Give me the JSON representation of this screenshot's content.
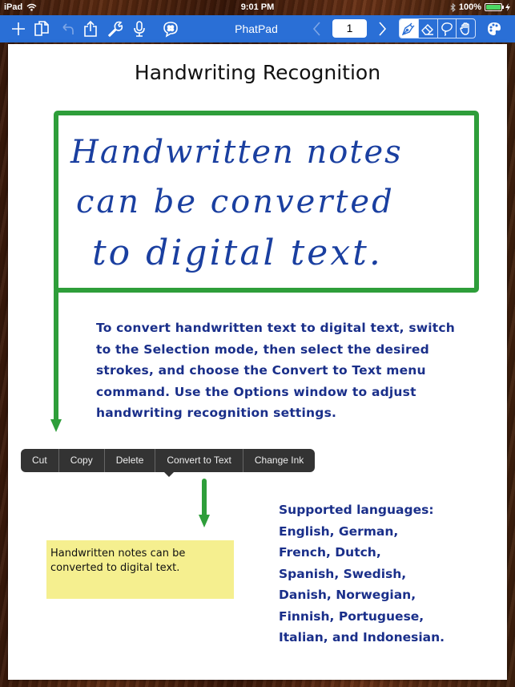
{
  "status_bar": {
    "device": "iPad",
    "time": "9:01 PM",
    "battery_percent": "100%",
    "battery_level": 1.0
  },
  "toolbar": {
    "title": "PhatPad",
    "page_number": "1",
    "left_icons": [
      "plus-icon",
      "pages-icon",
      "undo-icon",
      "share-icon",
      "wrench-icon",
      "microphone-icon",
      "chat-bubble-icon"
    ],
    "right_icons": [
      "chevron-left-icon",
      "chevron-right-icon"
    ],
    "modes": [
      {
        "name": "pen",
        "active": true
      },
      {
        "name": "eraser",
        "active": false
      },
      {
        "name": "lasso",
        "active": false
      },
      {
        "name": "hand",
        "active": false
      }
    ],
    "accent_color": "#2a6fd6"
  },
  "page": {
    "title": "Handwriting Recognition",
    "handwritten_lines": [
      "Handwritten notes",
      "can be converted",
      "to digital text."
    ],
    "instructions": "To convert handwritten text to digital text, switch to the Selection mode, then select the desired strokes, and choose the Convert to Text menu command. Use the Options window to adjust handwriting recognition settings.",
    "languages_lines": [
      "Supported languages:",
      "English, German,",
      "French, Dutch,",
      "Spanish, Swedish,",
      "Danish, Norwegian,",
      "Finnish, Portuguese,",
      "Italian, and Indonesian."
    ],
    "sticky_note": "Handwritten notes can be converted to digital text.",
    "ink_color": "#1a2f8a",
    "frame_color": "#2e9e3a",
    "note_color": "#f5ef8f"
  },
  "context_menu": {
    "items": [
      "Cut",
      "Copy",
      "Delete",
      "Convert to Text",
      "Change Ink"
    ]
  }
}
